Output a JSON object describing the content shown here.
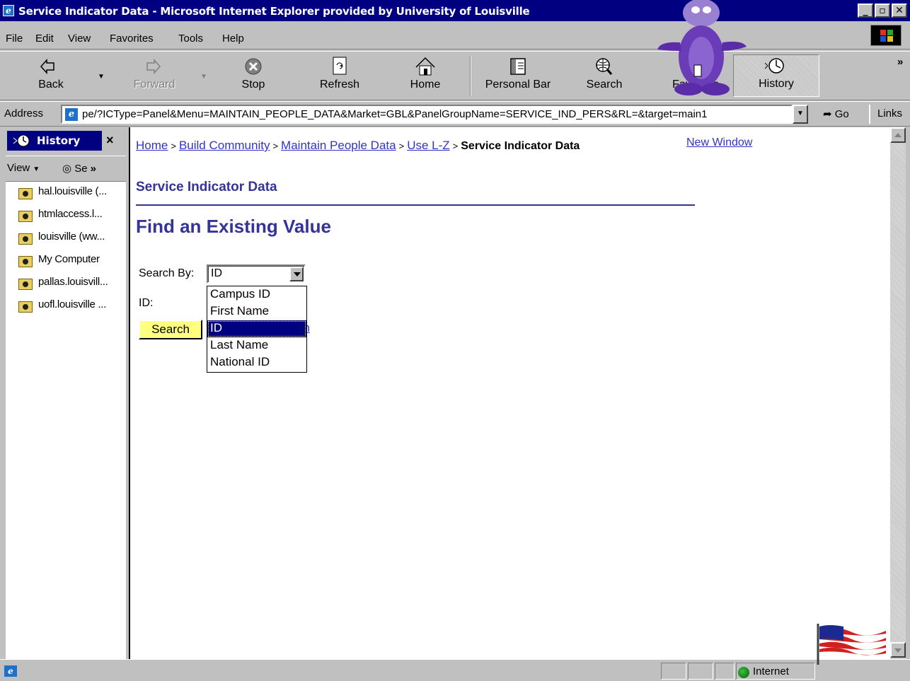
{
  "window": {
    "title": "Service Indicator Data - Microsoft Internet Explorer provided by University of Louisville",
    "controls": [
      "_",
      "▫",
      "✕"
    ]
  },
  "menu": [
    "File",
    "Edit",
    "View",
    "Favorites",
    "Tools",
    "Help"
  ],
  "toolbar": {
    "back": "Back",
    "forward": "Forward",
    "stop": "Stop",
    "refresh": "Refresh",
    "home": "Home",
    "personal_bar": "Personal Bar",
    "search": "Search",
    "favorites": "Favorites",
    "history": "History",
    "more": "»"
  },
  "address": {
    "label": "Address",
    "url": "pe/?ICType=Panel&Menu=MAINTAIN_PEOPLE_DATA&Market=GBL&PanelGroupName=SERVICE_IND_PERS&RL=&target=main1",
    "go": "Go",
    "links": "Links"
  },
  "history_pane": {
    "title": "History",
    "close": "×",
    "view": "View",
    "search": "Se",
    "more": "»",
    "items": [
      "hal.louisville (...",
      "htmlaccess.l...",
      "louisville (ww...",
      "My Computer",
      "pallas.louisvill...",
      "uofl.louisville ..."
    ]
  },
  "page": {
    "breadcrumbs": {
      "home": "Home",
      "build": "Build Community",
      "maintain": "Maintain People Data",
      "use": "Use L-Z",
      "current": "Service Indicator Data",
      "sep": ">"
    },
    "new_window": "New Window",
    "subtitle": "Service Indicator Data",
    "title": "Find an Existing Value",
    "search_by_label": "Search By:",
    "search_by_value": "ID",
    "id_label": "ID:",
    "search_button": "Search",
    "advanced_link_visible": "ch",
    "dropdown_options": [
      "Campus ID",
      "First Name",
      "ID",
      "Last Name",
      "National ID"
    ],
    "dropdown_selected_index": 2
  },
  "status": {
    "zone": "Internet"
  },
  "colors": {
    "titlebar": "#000080",
    "link": "#3333cc",
    "heading": "#333399",
    "search_button": "#ffff80"
  }
}
